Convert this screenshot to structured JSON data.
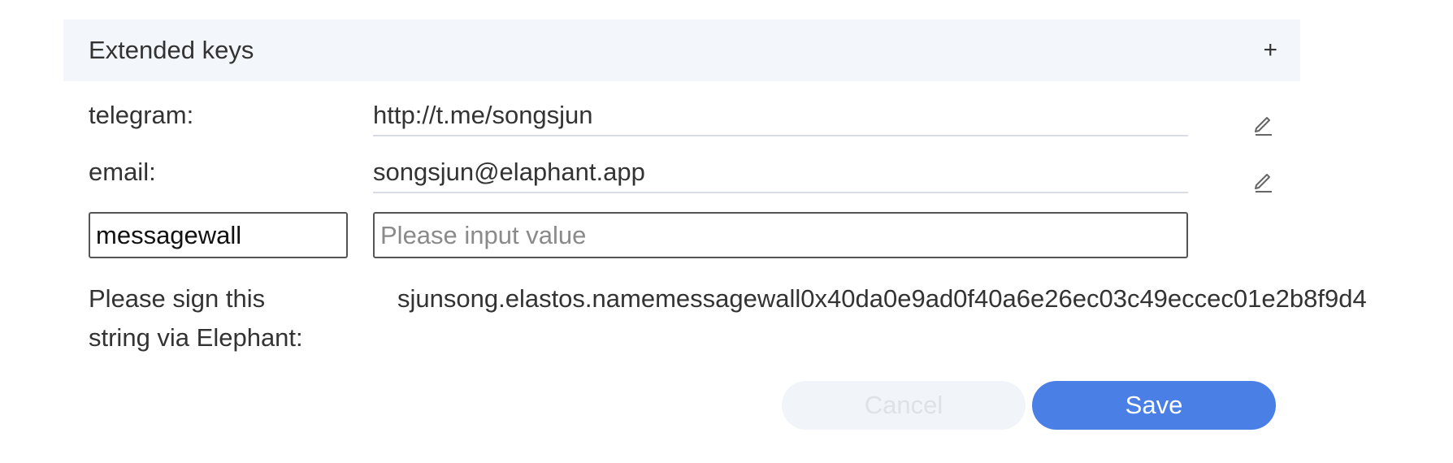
{
  "header": {
    "title": "Extended keys",
    "add_symbol": "+"
  },
  "fields": [
    {
      "label": "telegram:",
      "value": "http://t.me/songsjun"
    },
    {
      "label": "email:",
      "value": "songsjun@elaphant.app"
    }
  ],
  "new_entry": {
    "key_value": "messagewall",
    "value_placeholder": "Please input value",
    "value_value": ""
  },
  "sign": {
    "label": "Please sign this string via Elephant:",
    "string": "sjunsong.elastos.namemessagewall0x40da0e9ad0f40a6e26ec03c49eccec01e2b8f9d4"
  },
  "buttons": {
    "cancel_label": "Cancel",
    "save_label": "Save"
  },
  "colors": {
    "header_bg": "#f3f6fa",
    "accent": "#4a7fe6",
    "cancel_bg": "#f1f4f8"
  },
  "icons": {
    "add": "plus-icon",
    "edit": "pencil-icon"
  }
}
